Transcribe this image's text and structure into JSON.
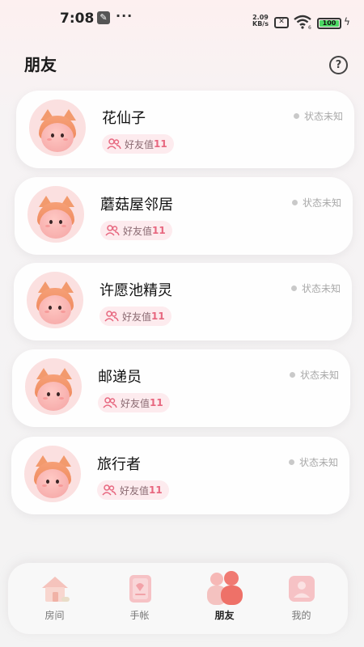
{
  "status_bar": {
    "time": "7:08",
    "speed_value": "2.09",
    "speed_unit": "KB/s",
    "wifi_sub": "6",
    "battery": "100"
  },
  "header": {
    "title": "朋友",
    "help_icon": "help-circle-icon"
  },
  "friends": [
    {
      "name": "花仙子",
      "status": "状态未知",
      "affinity_label": "好友值",
      "affinity_value": "11"
    },
    {
      "name": "蘑菇屋邻居",
      "status": "状态未知",
      "affinity_label": "好友值",
      "affinity_value": "11"
    },
    {
      "name": "许愿池精灵",
      "status": "状态未知",
      "affinity_label": "好友值",
      "affinity_value": "11"
    },
    {
      "name": "邮递员",
      "status": "状态未知",
      "affinity_label": "好友值",
      "affinity_value": "11"
    },
    {
      "name": "旅行者",
      "status": "状态未知",
      "affinity_label": "好友值",
      "affinity_value": "11"
    }
  ],
  "nav": {
    "items": [
      {
        "label": "房间",
        "icon": "house-icon",
        "active": false
      },
      {
        "label": "手帐",
        "icon": "notebook-icon",
        "active": false
      },
      {
        "label": "朋友",
        "icon": "friends-icon",
        "active": true
      },
      {
        "label": "我的",
        "icon": "profile-icon",
        "active": false
      }
    ]
  },
  "colors": {
    "accent": "#e7677f",
    "badge_bg": "#fdebee",
    "avatar_hood": "#f29a6d"
  }
}
